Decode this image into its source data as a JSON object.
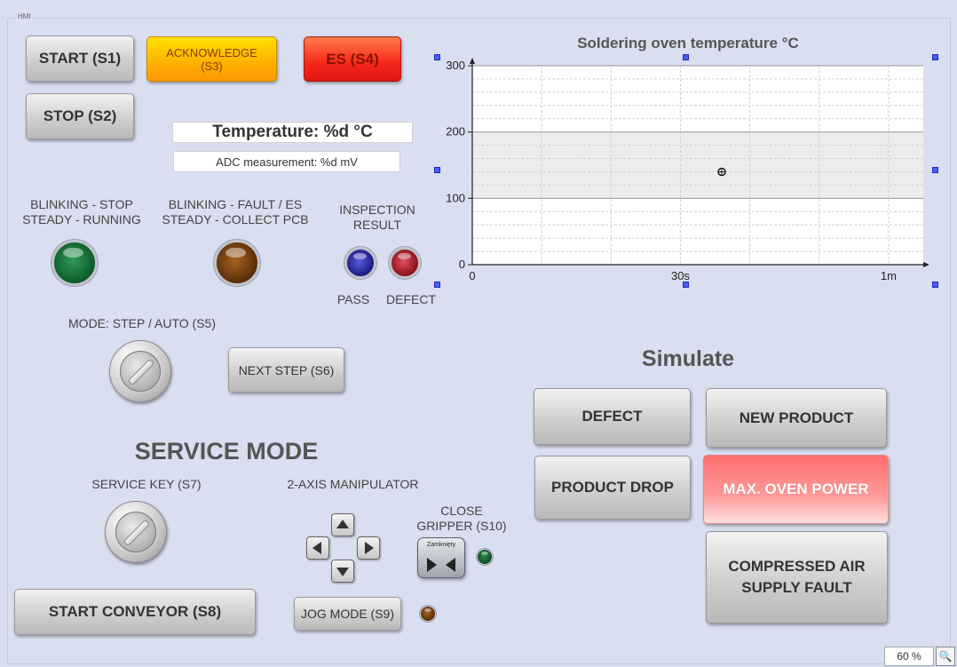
{
  "hmi_label": "HMI",
  "buttons": {
    "start": "START (S1)",
    "stop": "STOP (S2)",
    "acknowledge": "ACKNOWLEDGE\n(S3)",
    "es": "ES (S4)",
    "next_step": "NEXT STEP (S6)",
    "start_conveyor": "START CONVEYOR (S8)",
    "jog_mode": "JOG MODE (S9)"
  },
  "displays": {
    "temperature": "Temperature:  %d °C",
    "adc": "ADC measurement: %d mV"
  },
  "labels": {
    "lamp1": "BLINKING - STOP\nSTEADY - RUNNING",
    "lamp2": "BLINKING - FAULT / ES\nSTEADY - COLLECT PCB",
    "inspection": "INSPECTION\nRESULT",
    "pass": "PASS",
    "defect": "DEFECT",
    "mode": "MODE: STEP / AUTO  (S5)",
    "service_mode": "SERVICE MODE",
    "service_key": "SERVICE KEY (S7)",
    "manipulator": "2-AXIS MANIPULATOR",
    "close_gripper": "CLOSE\nGRIPPER (S10)",
    "gripper_caption": "Zamknięty",
    "simulate": "Simulate"
  },
  "simulate": {
    "defect": "DEFECT",
    "new_product": "NEW PRODUCT",
    "product_drop": "PRODUCT DROP",
    "max_oven_power": "MAX. OVEN POWER",
    "compressed_air": "COMPRESSED AIR\nSUPPLY FAULT"
  },
  "lamp_colors": {
    "lamp1": "#0c5a2a",
    "lamp2": "#5a2c08",
    "pass": "#1a1a80",
    "defect": "#8a0e18",
    "gripper": "#0f4a22",
    "jog": "#5a2e08"
  },
  "chart_data": {
    "type": "line",
    "title": "Soldering oven temperature °C",
    "x_tick_labels": [
      "0",
      "30s",
      "1m"
    ],
    "y_tick_labels": [
      "0",
      "100",
      "200",
      "300"
    ],
    "x_ticks_seconds": [
      0,
      30,
      60
    ],
    "xlim": [
      0,
      65
    ],
    "ylim": [
      0,
      300
    ],
    "y_ticks": [
      0,
      100,
      200,
      300
    ],
    "band": [
      100,
      200
    ],
    "series": []
  },
  "zoom": "60 %"
}
